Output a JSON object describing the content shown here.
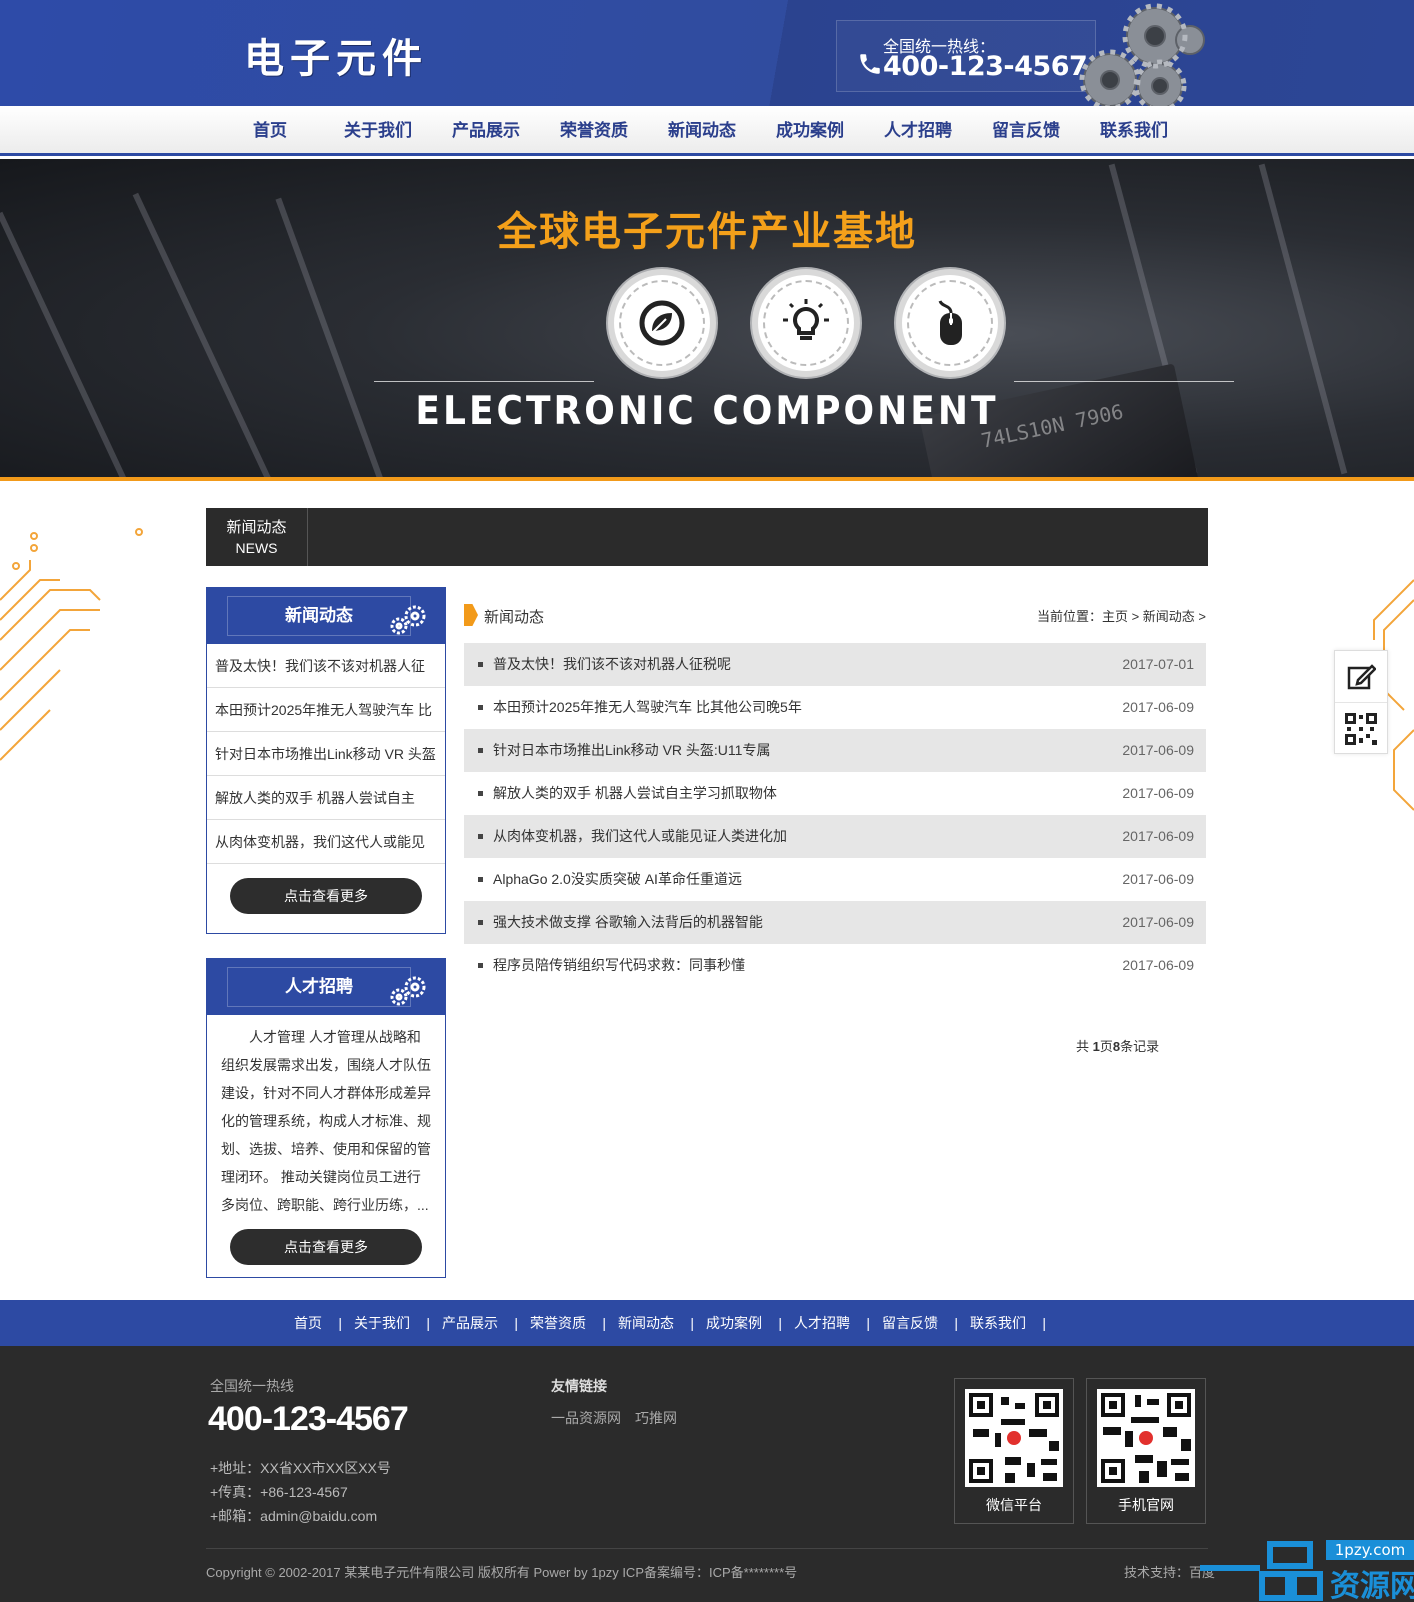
{
  "header": {
    "logo": "电子元件",
    "hotline_label": "全国统一热线：",
    "hotline_number": "400-123-4567"
  },
  "nav": [
    "首页",
    "关于我们",
    "产品展示",
    "荣誉资质",
    "新闻动态",
    "成功案例",
    "人才招聘",
    "留言反馈",
    "联系我们"
  ],
  "banner": {
    "title": "全球电子元件产业基地",
    "subtitle": "ELECTRONIC COMPONENT",
    "icons": [
      "leaf-icon",
      "lightbulb-icon",
      "mouse-icon"
    ],
    "chip_text": "74LS10N 7906"
  },
  "section_bar": {
    "cn": "新闻动态",
    "en": "NEWS"
  },
  "sidebar_news": {
    "title": "新闻动态",
    "items": [
      "普及太快！我们该不该对机器人征",
      "本田预计2025年推无人驾驶汽车 比",
      "针对日本市场推出Link移动 VR 头盔",
      "解放人类的双手 机器人尝试自主",
      "从肉体变机器，我们这代人或能见"
    ],
    "more": "点击查看更多"
  },
  "sidebar_jobs": {
    "title": "人才招聘",
    "text": "人才管理 人才管理从战略和组织发展需求出发，围绕人才队伍建设，针对不同人才群体形成差异化的管理系统，构成人才标准、规划、选拔、培养、使用和保留的管理闭环。 推动关键岗位员工进行多岗位、跨职能、跨行业历练，...",
    "more": "点击查看更多"
  },
  "list": {
    "section_title": "新闻动态",
    "crumb": "当前位置：主页 > 新闻动态 >",
    "rows": [
      {
        "title": "普及太快！我们该不该对机器人征税呢",
        "date": "2017-07-01"
      },
      {
        "title": "本田预计2025年推无人驾驶汽车 比其他公司晚5年",
        "date": "2017-06-09"
      },
      {
        "title": "针对日本市场推出Link移动 VR 头盔:U11专属",
        "date": "2017-06-09"
      },
      {
        "title": "解放人类的双手 机器人尝试自主学习抓取物体",
        "date": "2017-06-09"
      },
      {
        "title": "从肉体变机器，我们这代人或能见证人类进化加",
        "date": "2017-06-09"
      },
      {
        "title": "AlphaGo 2.0没实质突破 AI革命任重道远",
        "date": "2017-06-09"
      },
      {
        "title": "强大技术做支撑 谷歌输入法背后的机器智能",
        "date": "2017-06-09"
      },
      {
        "title": "程序员陪传销组织写代码求救：同事秒懂",
        "date": "2017-06-09"
      }
    ],
    "pager_prefix": "共 ",
    "pager_pages": "1",
    "pager_mid": "页",
    "pager_count": "8",
    "pager_suffix": "条记录"
  },
  "footer_nav": [
    "首页",
    "关于我们",
    "产品展示",
    "荣誉资质",
    "新闻动态",
    "成功案例",
    "人才招聘",
    "留言反馈",
    "联系我们"
  ],
  "footer_nav_separator": "|",
  "footer": {
    "hotline_label": "全国统一热线",
    "hotline_number": "400-123-4567",
    "address": "+地址：XX省XX市XX区XX号",
    "fax": "+传真：+86-123-4567",
    "email": "+邮箱：admin@baidu.com",
    "links_title": "友情链接",
    "links": [
      "一品资源网",
      "巧推网"
    ],
    "qr_wechat": "微信平台",
    "qr_mobile": "手机官网",
    "copyright": "Copyright © 2002-2017 某某电子元件有限公司 版权所有 Power by 1pzy    ICP备案编号：ICP备********号",
    "tech": "技术支持：百度"
  },
  "watermark": {
    "domain": "1pzy.com",
    "name": "资源网"
  },
  "colors": {
    "brand_blue": "#2d4aa3",
    "accent_orange": "#f29a1a",
    "dark": "#2b2b2b"
  }
}
